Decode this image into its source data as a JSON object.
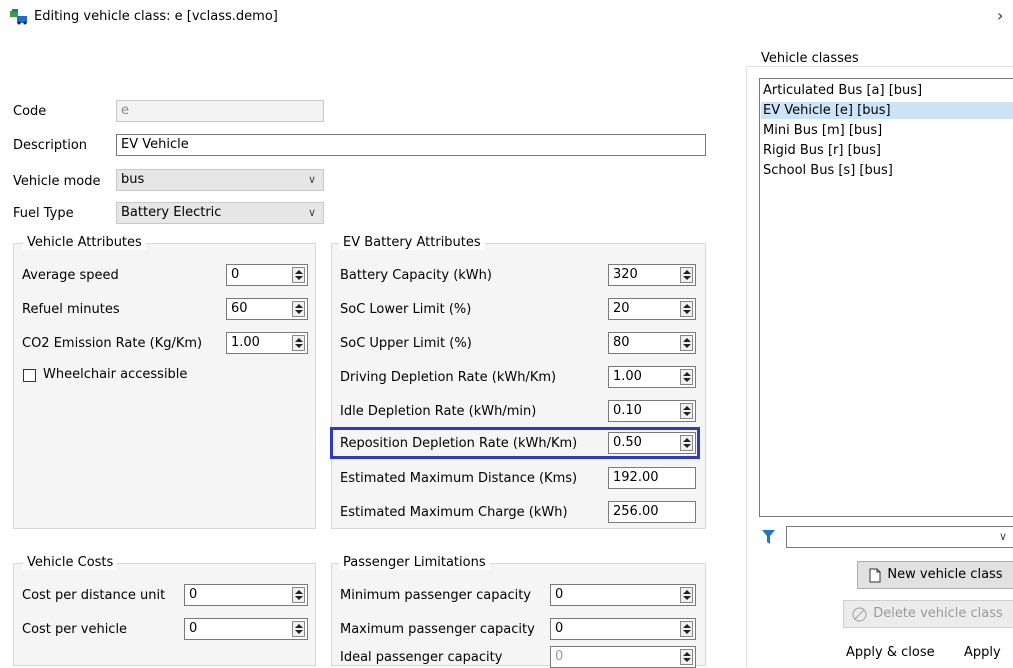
{
  "window": {
    "title": "Editing vehicle class: e [vclass.demo]",
    "close_glyph": "›"
  },
  "form": {
    "code_label": "Code",
    "code_value": "e",
    "description_label": "Description",
    "description_value": "EV Vehicle",
    "vehicle_mode_label": "Vehicle mode",
    "vehicle_mode_value": "bus",
    "fuel_type_label": "Fuel Type",
    "fuel_type_value": "Battery Electric"
  },
  "vehicle_attributes": {
    "title": "Vehicle Attributes",
    "average_speed_label": "Average speed",
    "average_speed_value": "0",
    "refuel_minutes_label": "Refuel minutes",
    "refuel_minutes_value": "60",
    "co2_label": "CO2 Emission Rate (Kg/Km)",
    "co2_value": "1.00",
    "wheelchair_label": "Wheelchair accessible"
  },
  "ev_battery": {
    "title": "EV Battery Attributes",
    "battery_capacity_label": "Battery Capacity (kWh)",
    "battery_capacity_value": "320",
    "soc_lower_label": "SoC Lower Limit (%)",
    "soc_lower_value": "20",
    "soc_upper_label": "SoC Upper Limit (%)",
    "soc_upper_value": "80",
    "driving_depletion_label": "Driving Depletion Rate (kWh/Km)",
    "driving_depletion_value": "1.00",
    "idle_depletion_label": "Idle Depletion Rate (kWh/min)",
    "idle_depletion_value": "0.10",
    "reposition_depletion_label": "Reposition Depletion Rate (kWh/Km)",
    "reposition_depletion_value": "0.50",
    "est_max_distance_label": "Estimated Maximum Distance (Kms)",
    "est_max_distance_value": "192.00",
    "est_max_charge_label": "Estimated Maximum Charge (kWh)",
    "est_max_charge_value": "256.00"
  },
  "vehicle_costs": {
    "title": "Vehicle Costs",
    "cost_per_distance_label": "Cost per distance unit",
    "cost_per_distance_value": "0",
    "cost_per_vehicle_label": "Cost per vehicle",
    "cost_per_vehicle_value": "0"
  },
  "passenger_limitations": {
    "title": "Passenger Limitations",
    "min_capacity_label": "Minimum passenger capacity",
    "min_capacity_value": "0",
    "max_capacity_label": "Maximum passenger capacity",
    "max_capacity_value": "0",
    "ideal_capacity_label": "Ideal passenger capacity",
    "ideal_capacity_value": "0"
  },
  "vehicle_classes": {
    "title": "Vehicle classes",
    "items": [
      "Articulated Bus [a] [bus]",
      "EV Vehicle [e] [bus]",
      "Mini Bus [m] [bus]",
      "Rigid Bus [r] [bus]",
      "School Bus [s] [bus]"
    ],
    "selected_index": 1,
    "filter_value": "",
    "new_button": "New vehicle class",
    "delete_button": "Delete vehicle class",
    "apply_close_button": "Apply & close",
    "apply_button": "Apply"
  },
  "colors": {
    "highlight": "#2c3bbf",
    "selection": "#cce4f7",
    "filter_icon": "#1e74c8"
  },
  "icons": {
    "window": "vehicle-class-icon",
    "filter": "filter-icon",
    "new": "document-icon",
    "delete": "prohibited-icon",
    "dropdown": "chevron-down-icon"
  }
}
